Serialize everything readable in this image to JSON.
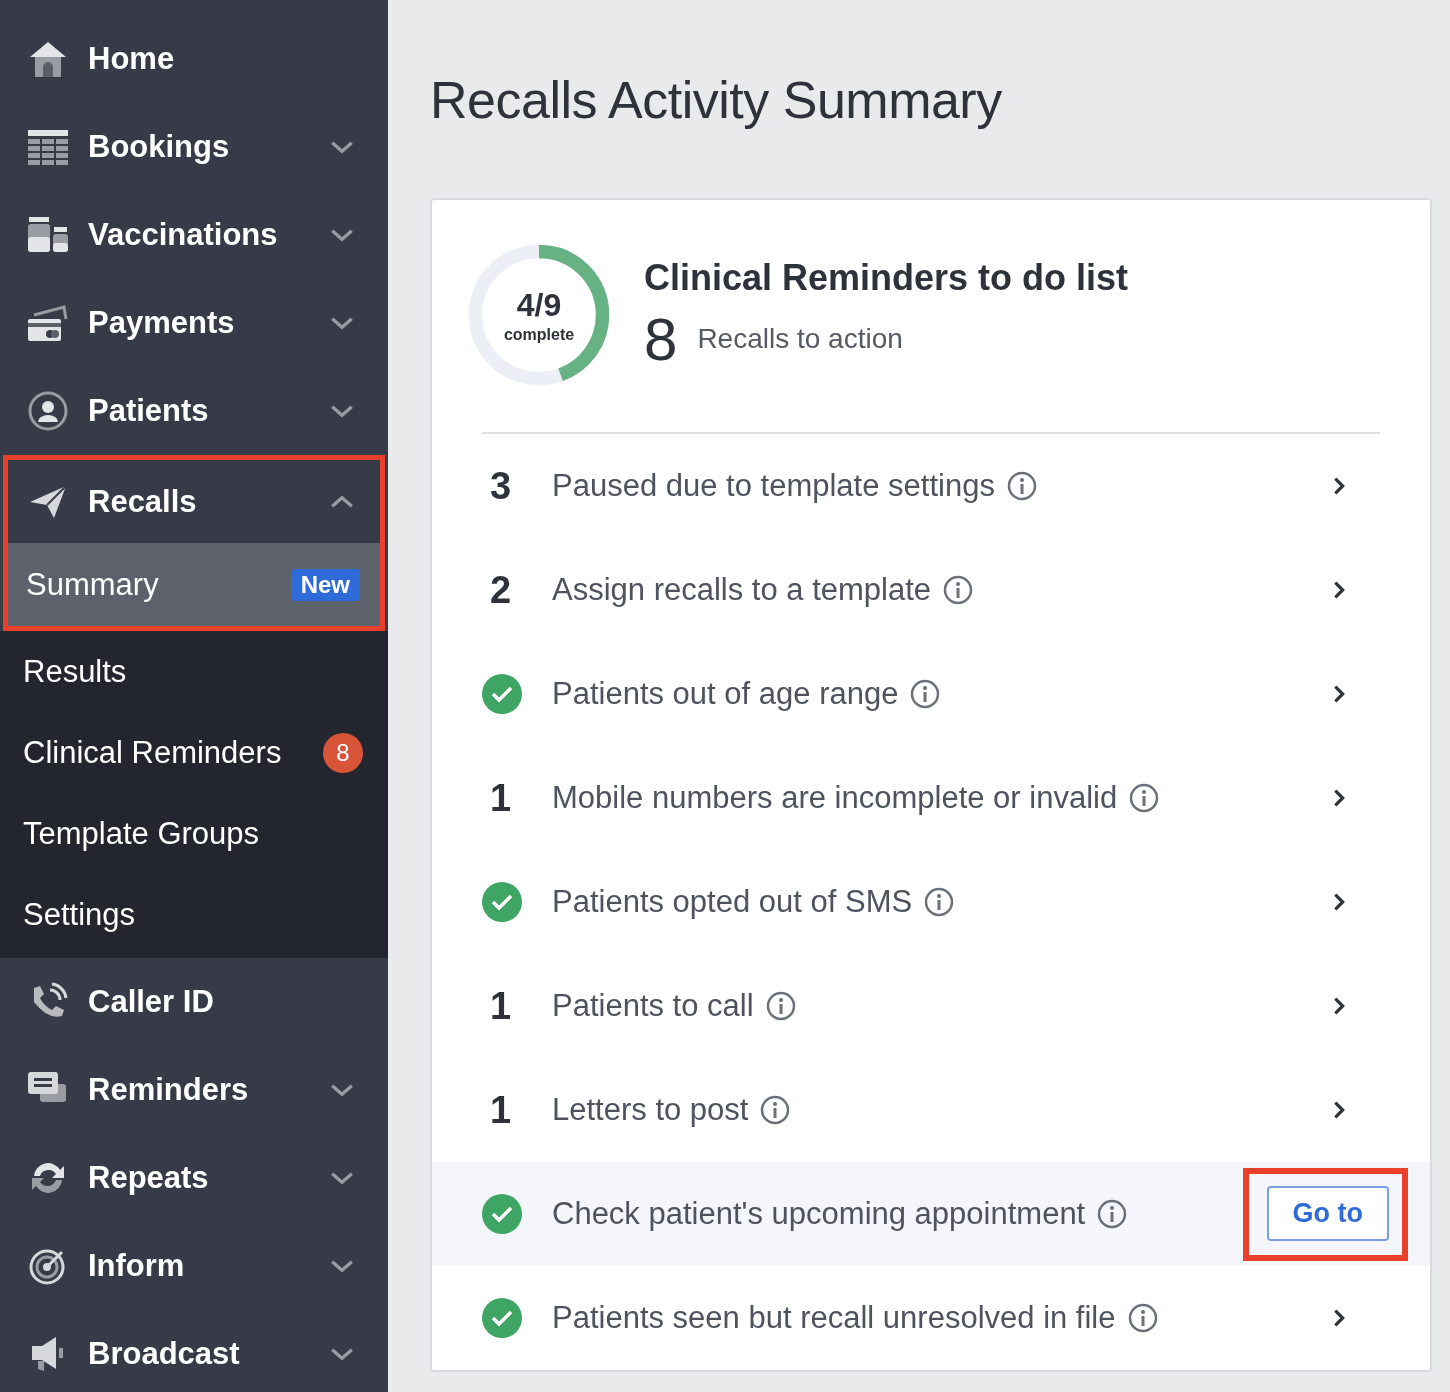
{
  "sidebar": {
    "items": [
      {
        "label": "Home"
      },
      {
        "label": "Bookings",
        "expanded": false
      },
      {
        "label": "Vaccinations",
        "expanded": false
      },
      {
        "label": "Payments",
        "expanded": false
      },
      {
        "label": "Patients",
        "expanded": false
      },
      {
        "label": "Recalls",
        "expanded": true,
        "annotated": true,
        "children": [
          {
            "label": "Summary",
            "selected": true,
            "badge": {
              "text": "New",
              "color": "#2f6ad9"
            }
          },
          {
            "label": "Results",
            "selected": false
          },
          {
            "label": "Clinical Reminders",
            "selected": false,
            "badge": {
              "text": "8",
              "color": "#d9553a"
            }
          },
          {
            "label": "Template Groups",
            "selected": false
          },
          {
            "label": "Settings",
            "selected": false
          }
        ]
      },
      {
        "label": "Caller ID"
      },
      {
        "label": "Reminders",
        "expanded": false
      },
      {
        "label": "Repeats",
        "expanded": false
      },
      {
        "label": "Inform",
        "expanded": false
      },
      {
        "label": "Broadcast",
        "expanded": false
      }
    ]
  },
  "title": "Recalls Activity Summary",
  "summary": {
    "progress": {
      "value": "4/9",
      "caption": "complete",
      "level": 0.444
    },
    "heading": "Clinical Reminders to do list",
    "count": "8",
    "count_label": "Recalls to action"
  },
  "rows": [
    {
      "kind": "count",
      "count": "3",
      "label": "Paused due to template settings",
      "highlighted": false
    },
    {
      "kind": "count",
      "count": "2",
      "label": "Assign recalls to a template",
      "highlighted": false
    },
    {
      "kind": "done",
      "label": "Patients out of age range",
      "highlighted": false
    },
    {
      "kind": "count",
      "count": "1",
      "label": "Mobile numbers are incomplete or invalid",
      "highlighted": false
    },
    {
      "kind": "done",
      "label": "Patients opted out of SMS",
      "highlighted": false
    },
    {
      "kind": "count",
      "count": "1",
      "label": "Patients to call",
      "highlighted": false
    },
    {
      "kind": "count",
      "count": "1",
      "label": "Letters to post",
      "highlighted": false
    },
    {
      "kind": "done",
      "label": "Check patient's upcoming appointment",
      "highlighted": true,
      "button": "Go to",
      "annotated": true
    },
    {
      "kind": "done",
      "label": "Patients seen but recall unresolved in file",
      "highlighted": false
    }
  ]
}
